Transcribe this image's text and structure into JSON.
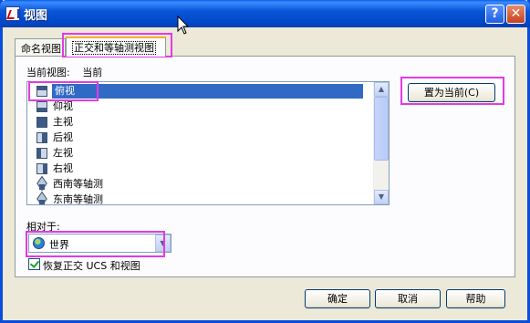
{
  "window": {
    "title": "视图",
    "help_symbol": "?",
    "close_symbol": "✕"
  },
  "tabs": [
    {
      "label": "命名视图"
    },
    {
      "label": "正交和等轴测视图",
      "active": true
    }
  ],
  "current_view": {
    "label": "当前视图:",
    "value": "当前"
  },
  "views": [
    {
      "label": "俯视",
      "icon": "top-view-cube-icon",
      "selected": true
    },
    {
      "label": "仰视",
      "icon": "bottom-view-cube-icon"
    },
    {
      "label": "主视",
      "icon": "front-view-cube-icon"
    },
    {
      "label": "后视",
      "icon": "back-view-cube-icon"
    },
    {
      "label": "左视",
      "icon": "left-view-cube-icon"
    },
    {
      "label": "右视",
      "icon": "right-view-cube-icon"
    },
    {
      "label": "西南等轴测",
      "icon": "sw-isometric-icon"
    },
    {
      "label": "东南等轴测",
      "icon": "se-isometric-icon"
    }
  ],
  "set_current_button": "置为当前(C)",
  "relative_to": {
    "label": "相对于:",
    "value": "世界"
  },
  "restore_checkbox": {
    "label": "恢复正交 UCS 和视图",
    "checked": true
  },
  "footer": {
    "ok": "确定",
    "cancel": "取消",
    "help": "帮助"
  },
  "colors": {
    "titlebar": "#0a56d8",
    "selection": "#316ac5",
    "highlight": "#e43ae4"
  }
}
